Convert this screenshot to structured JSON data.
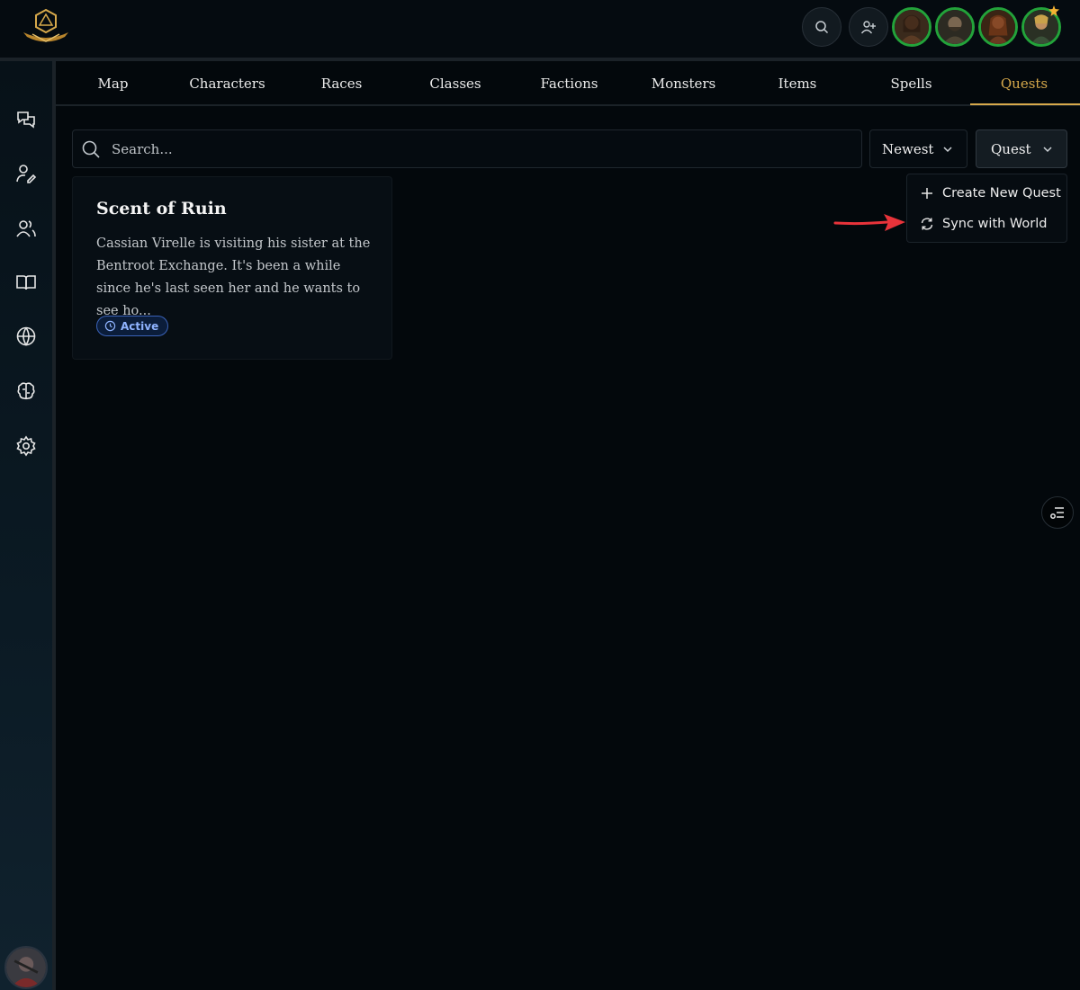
{
  "app": {
    "logo_icon": "d20-dice-logo-icon"
  },
  "header": {
    "search_icon": "search-icon",
    "add_user_icon": "user-plus-icon",
    "party_avatars": [
      "character-avatar-1",
      "character-avatar-2",
      "character-avatar-3",
      "character-avatar-4"
    ],
    "accent_ring_color": "#23a33a"
  },
  "sidebar": {
    "items": [
      {
        "icon": "chat-icon"
      },
      {
        "icon": "user-edit-icon"
      },
      {
        "icon": "users-icon"
      },
      {
        "icon": "book-icon"
      },
      {
        "icon": "globe-icon"
      },
      {
        "icon": "brain-icon"
      },
      {
        "icon": "gear-icon"
      }
    ],
    "profile_icon": "user-profile-avatar"
  },
  "tabs": [
    {
      "label": "Map"
    },
    {
      "label": "Characters"
    },
    {
      "label": "Races"
    },
    {
      "label": "Classes"
    },
    {
      "label": "Factions"
    },
    {
      "label": "Monsters"
    },
    {
      "label": "Items"
    },
    {
      "label": "Spells"
    },
    {
      "label": "Quests",
      "active": true
    }
  ],
  "toolbar": {
    "search_placeholder": "Search...",
    "sort_label": "Newest",
    "type_label": "Quest"
  },
  "menu": {
    "items": [
      {
        "label": "Create New Quest",
        "icon": "plus-icon"
      },
      {
        "label": "Sync with World",
        "icon": "refresh-icon"
      }
    ]
  },
  "quests": [
    {
      "title": "Scent of Ruin",
      "description": "Cassian Virelle is visiting his sister at the Bentroot Exchange. It's been a while since he's last seen her and he wants to see ho...",
      "status": "Active"
    }
  ],
  "colors": {
    "background": "#03080c",
    "accent_gold": "#d7a94b",
    "status_blue": "#8fb3ff",
    "annotation_red": "#e8333a"
  }
}
